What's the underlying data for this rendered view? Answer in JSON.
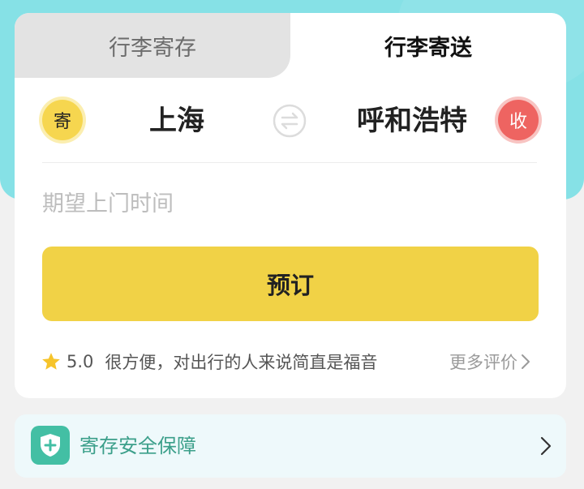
{
  "tabs": [
    {
      "label": "行李寄存",
      "active": false
    },
    {
      "label": "行李寄送",
      "active": true
    }
  ],
  "route": {
    "from_badge": "寄",
    "from_city": "上海",
    "to_city": "呼和浩特",
    "to_badge": "收",
    "swap_icon": "swap-arrows-icon"
  },
  "time_field": {
    "placeholder": "期望上门时间"
  },
  "book_button": {
    "label": "预订"
  },
  "review": {
    "rating": "5.0",
    "text": "很方便，对出行的人来说简直是福音",
    "more_label": "更多评价",
    "star_icon": "star-icon"
  },
  "safety": {
    "label": "寄存安全保障",
    "icon": "shield-plus-icon"
  },
  "colors": {
    "header_bg": "#86e1e6",
    "accent_yellow": "#f1d246",
    "receive_red": "#ee6461",
    "safety_green": "#43bfa4"
  }
}
